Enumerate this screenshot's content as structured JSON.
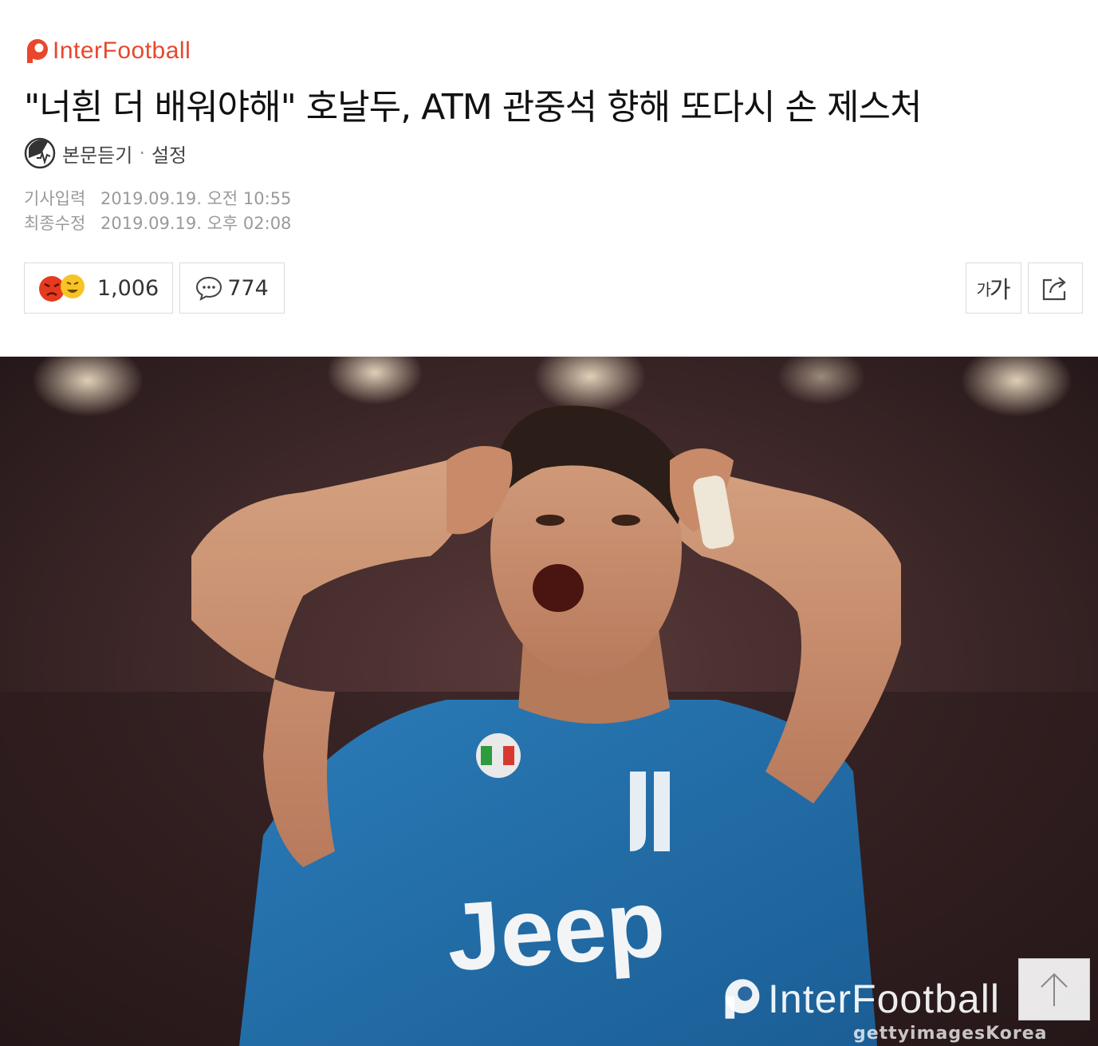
{
  "brand": {
    "name": "InterFootball",
    "color": "#e8472c"
  },
  "article": {
    "headline": "\"너흰 더 배워야해\" 호날두, ATM 관중석 향해 또다시 손 제스처",
    "tts_label": "본문듣기",
    "tts_separator": "·",
    "tts_settings": "설정",
    "published_label": "기사입력",
    "published": "2019.09.19. 오전 10:55",
    "modified_label": "최종수정",
    "modified": "2019.09.19. 오후 02:08"
  },
  "actions": {
    "reaction_count": "1,006",
    "reaction_icons": [
      "angry-face-icon",
      "laughing-face-icon"
    ],
    "comment_count": "774",
    "font_small": "가",
    "font_big": "가",
    "share_icon": "share-icon"
  },
  "photo": {
    "watermark": "InterFootball",
    "credit": "gettyimagesKorea",
    "jersey_text": "Jeep"
  },
  "scroll_top_icon": "arrow-up-icon"
}
